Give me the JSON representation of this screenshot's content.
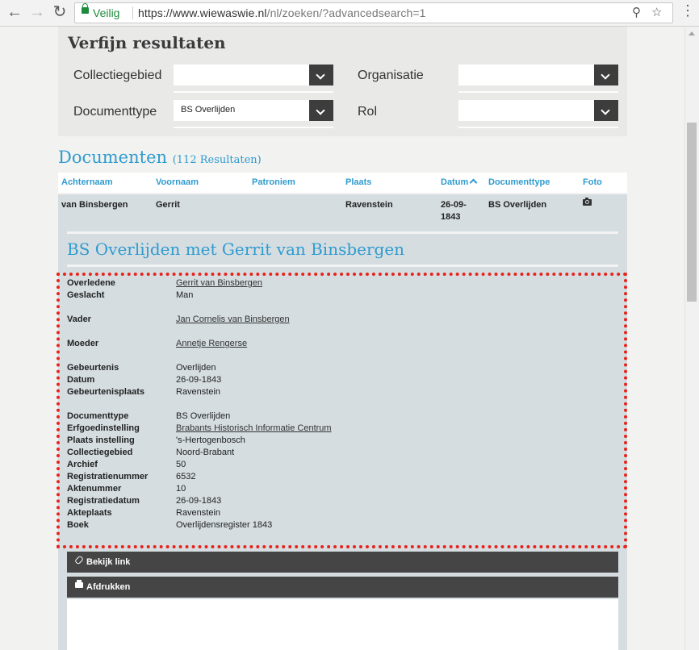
{
  "browser": {
    "secure_label": "Veilig",
    "url_host": "https://www.wiewaswie.nl",
    "url_path": "/nl/zoeken/?advancedsearch=1"
  },
  "refine": {
    "title": "Verfijn resultaten",
    "filters": {
      "collectiegebied": {
        "label": "Collectiegebied",
        "value": ""
      },
      "organisatie": {
        "label": "Organisatie",
        "value": ""
      },
      "documenttype": {
        "label": "Documenttype",
        "value": "BS Overlijden"
      },
      "rol": {
        "label": "Rol",
        "value": ""
      }
    }
  },
  "documents": {
    "title": "Documenten",
    "count": "(112 Resultaten)"
  },
  "table": {
    "columns": [
      "Achternaam",
      "Voornaam",
      "Patroniem",
      "Plaats",
      "Datum",
      "Documenttype",
      "Foto"
    ],
    "row": {
      "achternaam": "van Binsbergen",
      "voornaam": "Gerrit",
      "patroniem": "",
      "plaats": "Ravenstein",
      "datum_line1": "26-09-",
      "datum_line2": "1843",
      "documenttype": "BS Overlijden"
    }
  },
  "detail": {
    "title": "BS Overlijden met Gerrit van Binsbergen",
    "fields": [
      {
        "key": "Overledene",
        "value": "Gerrit van Binsbergen",
        "link": true
      },
      {
        "key": "Geslacht",
        "value": "Man",
        "link": false
      },
      {
        "key": "Vader",
        "value": "Jan Cornelis van Binsbergen",
        "link": true
      },
      {
        "key": "Moeder",
        "value": "Annetje Rengerse",
        "link": true
      },
      {
        "key": "Gebeurtenis",
        "value": "Overlijden",
        "link": false
      },
      {
        "key": "Datum",
        "value": "26-09-1843",
        "link": false
      },
      {
        "key": "Gebeurtenisplaats",
        "value": "Ravenstein",
        "link": false
      },
      {
        "key": "Documenttype",
        "value": "BS Overlijden",
        "link": false
      },
      {
        "key": "Erfgoedinstelling",
        "value": "Brabants Historisch Informatie Centrum",
        "link": true
      },
      {
        "key": "Plaats instelling",
        "value": "'s-Hertogenbosch",
        "link": false
      },
      {
        "key": "Collectiegebied",
        "value": "Noord-Brabant",
        "link": false
      },
      {
        "key": "Archief",
        "value": "50",
        "link": false
      },
      {
        "key": "Registratienummer",
        "value": "6532",
        "link": false
      },
      {
        "key": "Aktenummer",
        "value": "10",
        "link": false
      },
      {
        "key": "Registratiedatum",
        "value": "26-09-1843",
        "link": false
      },
      {
        "key": "Akteplaats",
        "value": "Ravenstein",
        "link": false
      },
      {
        "key": "Boek",
        "value": "Overlijdensregister 1843",
        "link": false
      }
    ]
  },
  "actions": {
    "view_link": "Bekijk link",
    "print": "Afdrukken"
  },
  "colors": {
    "accent": "#2f9bcf",
    "highlight": "#e8231b",
    "secure": "#1e8a3c"
  }
}
